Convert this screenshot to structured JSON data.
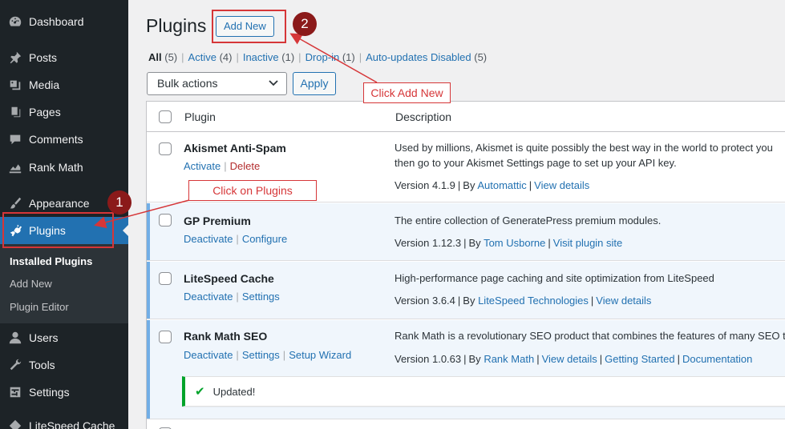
{
  "sidebar": {
    "items": [
      {
        "label": "Dashboard",
        "icon": "dashboard-icon"
      },
      {
        "label": "Posts",
        "icon": "pin-icon"
      },
      {
        "label": "Media",
        "icon": "media-icon"
      },
      {
        "label": "Pages",
        "icon": "pages-icon"
      },
      {
        "label": "Comments",
        "icon": "comment-icon"
      },
      {
        "label": "Rank Math",
        "icon": "chart-icon"
      },
      {
        "label": "Appearance",
        "icon": "brush-icon"
      },
      {
        "label": "Plugins",
        "icon": "plug-icon"
      },
      {
        "label": "Users",
        "icon": "user-icon"
      },
      {
        "label": "Tools",
        "icon": "wrench-icon"
      },
      {
        "label": "Settings",
        "icon": "settings-icon"
      },
      {
        "label": "LiteSpeed Cache",
        "icon": "diamond-icon"
      }
    ],
    "submenu": [
      "Installed Plugins",
      "Add New",
      "Plugin Editor"
    ]
  },
  "header": {
    "title": "Plugins",
    "add_new": "Add New"
  },
  "filters": [
    {
      "label": "All",
      "count": "(5)"
    },
    {
      "label": "Active",
      "count": "(4)"
    },
    {
      "label": "Inactive",
      "count": "(1)"
    },
    {
      "label": "Drop-in",
      "count": "(1)"
    },
    {
      "label": "Auto-updates Disabled",
      "count": "(5)"
    }
  ],
  "bulk": {
    "selected": "Bulk actions",
    "apply": "Apply"
  },
  "table": {
    "col_plugin": "Plugin",
    "col_description": "Description",
    "rows": [
      {
        "name": "Akismet Anti-Spam",
        "actions": [
          "Activate",
          "Delete"
        ],
        "description": "Used by millions, Akismet is quite possibly the best way in the world to protect you",
        "description2": "then go to your Akismet Settings page to set up your API key.",
        "version": "Version 4.1.9",
        "by": "By",
        "author": "Automattic",
        "links": [
          "View details"
        ]
      },
      {
        "name": "GP Premium",
        "actions": [
          "Deactivate",
          "Configure"
        ],
        "description": "The entire collection of GeneratePress premium modules.",
        "version": "Version 1.12.3",
        "by": "By",
        "author": "Tom Usborne",
        "links": [
          "Visit plugin site"
        ]
      },
      {
        "name": "LiteSpeed Cache",
        "actions": [
          "Deactivate",
          "Settings"
        ],
        "description": "High-performance page caching and site optimization from LiteSpeed",
        "version": "Version 3.6.4",
        "by": "By",
        "author": "LiteSpeed Technologies",
        "links": [
          "View details"
        ]
      },
      {
        "name": "Rank Math SEO",
        "actions": [
          "Deactivate",
          "Settings",
          "Setup Wizard"
        ],
        "description": "Rank Math is a revolutionary SEO product that combines the features of many SEO t",
        "version": "Version 1.0.63",
        "by": "By",
        "author": "Rank Math",
        "links": [
          "View details",
          "Getting Started",
          "Documentation"
        ]
      }
    ],
    "updated_notice": "Updated!"
  },
  "annotations": {
    "badge1": "1",
    "badge2": "2",
    "label1": "Click on Plugins",
    "label2": "Click Add New",
    "color": "#d63638",
    "badge_color": "#8b1a1a"
  }
}
